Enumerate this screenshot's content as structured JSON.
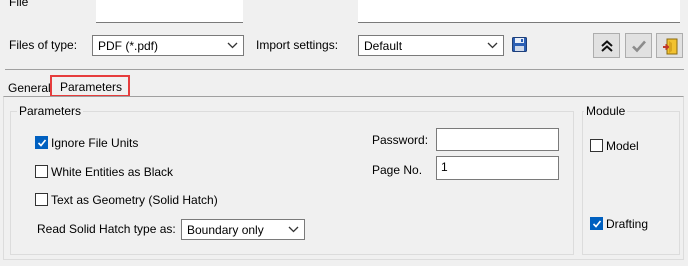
{
  "file_name_row": {
    "label": "File"
  },
  "filter_row": {
    "files_of_type_label": "Files of type:",
    "files_of_type_value": "PDF (*.pdf)",
    "import_settings_label": "Import settings:",
    "import_settings_value": "Default"
  },
  "toolbar": {
    "save_icon": "floppy-disk-icon",
    "collapse_icon": "double-chevron-up-icon",
    "ok_icon": "checkmark-icon",
    "exit_icon": "exit-door-icon"
  },
  "tabs": [
    {
      "label": "General",
      "active": false
    },
    {
      "label": "Parameters",
      "active": true
    }
  ],
  "parameters": {
    "group_title": "Parameters",
    "options": [
      {
        "label": "Ignore File Units",
        "checked": true
      },
      {
        "label": "White Entities as Black",
        "checked": false
      },
      {
        "label": "Text as Geometry (Solid Hatch)",
        "checked": false
      }
    ],
    "read_solid_hatch_label": "Read Solid Hatch type as:",
    "read_solid_hatch_value": "Boundary only",
    "password_label": "Password:",
    "password_value": "",
    "page_no_label": "Page No.",
    "page_no_value": "1"
  },
  "module": {
    "group_title": "Module",
    "model_label": "Model",
    "model_checked": false,
    "drafting_label": "Drafting",
    "drafting_checked": true
  },
  "colors": {
    "accent": "#0060c0",
    "highlight": "#e63c3c"
  }
}
